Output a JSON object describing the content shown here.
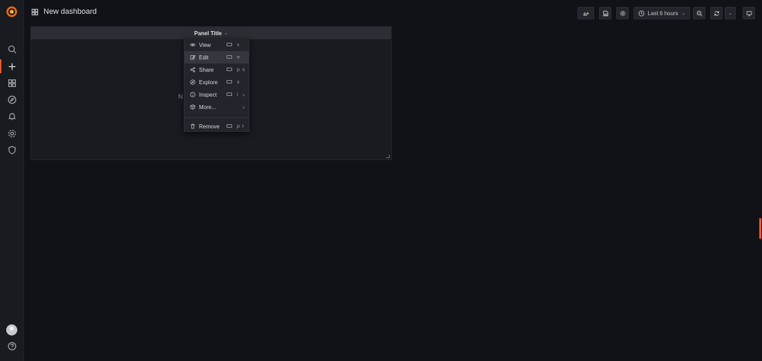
{
  "header": {
    "title": "New dashboard"
  },
  "toolbar": {
    "add_panel_icon": "add-panel-icon",
    "save_icon": "save-icon",
    "settings_icon": "gear-icon",
    "time_range_label": "Last 6 hours",
    "zoom_out_icon": "zoom-out-icon",
    "refresh_icon": "refresh-icon",
    "tv_mode_icon": "tv-icon"
  },
  "sidebar": {
    "items": [
      {
        "name": "search",
        "icon": "search-icon"
      },
      {
        "name": "create",
        "icon": "plus-icon"
      },
      {
        "name": "dashboards",
        "icon": "grid-icon"
      },
      {
        "name": "explore",
        "icon": "compass-icon"
      },
      {
        "name": "alerting",
        "icon": "bell-icon"
      },
      {
        "name": "configuration",
        "icon": "gear-icon"
      },
      {
        "name": "server-admin",
        "icon": "shield-icon"
      },
      {
        "name": "help",
        "icon": "help-icon"
      }
    ]
  },
  "panel": {
    "title": "Panel Title",
    "no_data_text": "N"
  },
  "menu": {
    "items": [
      {
        "label": "View",
        "shortcut": "v",
        "icon": "eye-icon"
      },
      {
        "label": "Edit",
        "shortcut": "e",
        "icon": "edit-icon"
      },
      {
        "label": "Share",
        "shortcut": "p s",
        "icon": "share-icon"
      },
      {
        "label": "Explore",
        "shortcut": "x",
        "icon": "compass-icon"
      },
      {
        "label": "Inspect",
        "shortcut": "i",
        "icon": "info-icon"
      },
      {
        "label": "More...",
        "shortcut": "",
        "icon": "cube-icon"
      },
      {
        "label": "Remove",
        "shortcut": "p r",
        "icon": "trash-icon"
      }
    ]
  },
  "colors": {
    "accent": "#f05a28",
    "background": "#111217",
    "panel": "#181b1f"
  }
}
